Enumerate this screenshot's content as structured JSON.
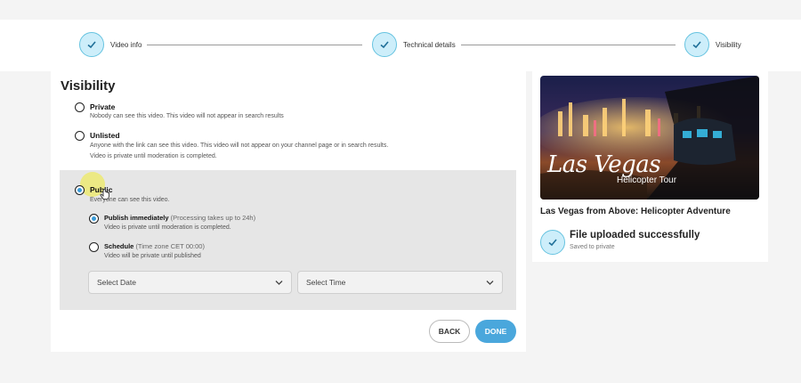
{
  "stepper": {
    "steps": [
      {
        "label": "Video info",
        "status": "complete"
      },
      {
        "label": "Technical details",
        "status": "complete"
      },
      {
        "label": "Visibility",
        "status": "complete"
      }
    ]
  },
  "visibility": {
    "title": "Visibility",
    "options": [
      {
        "id": "private",
        "label": "Private",
        "desc": "Nobody can see this video. This video will not appear in search results",
        "selected": false
      },
      {
        "id": "unlisted",
        "label": "Unlisted",
        "desc": "Anyone with the link can see this video. This video will not appear on your channel page or in search results.",
        "desc2": "Video is private until moderation is completed.",
        "selected": false
      },
      {
        "id": "public",
        "label": "Public",
        "desc": "Everyone can see this video.",
        "selected": true
      }
    ],
    "public_suboptions": [
      {
        "id": "publish_immediately",
        "label": "Publish immediately",
        "note": "(Processing takes up to 24h)",
        "desc": "Video is private until moderation is completed.",
        "selected": true
      },
      {
        "id": "schedule",
        "label": "Schedule",
        "note": "(Time zone CET 00:00)",
        "desc": "Video will be private until published",
        "selected": false
      }
    ],
    "date_select": {
      "value": "Select Date"
    },
    "time_select": {
      "value": "Select Time"
    }
  },
  "actions": {
    "back_label": "BACK",
    "done_label": "DONE"
  },
  "preview": {
    "thumbnail_title": "Las Vegas",
    "thumbnail_subtitle": "Helicopter Tour",
    "video_title": "Las Vegas from Above: Helicopter Adventure",
    "upload_status": "File uploaded successfully",
    "upload_substatus": "Saved to private"
  },
  "colors": {
    "accent": "#4aa7dc",
    "step_fill": "#cdeefa",
    "step_border": "#66c3e0",
    "highlight": "#f0eb50"
  }
}
